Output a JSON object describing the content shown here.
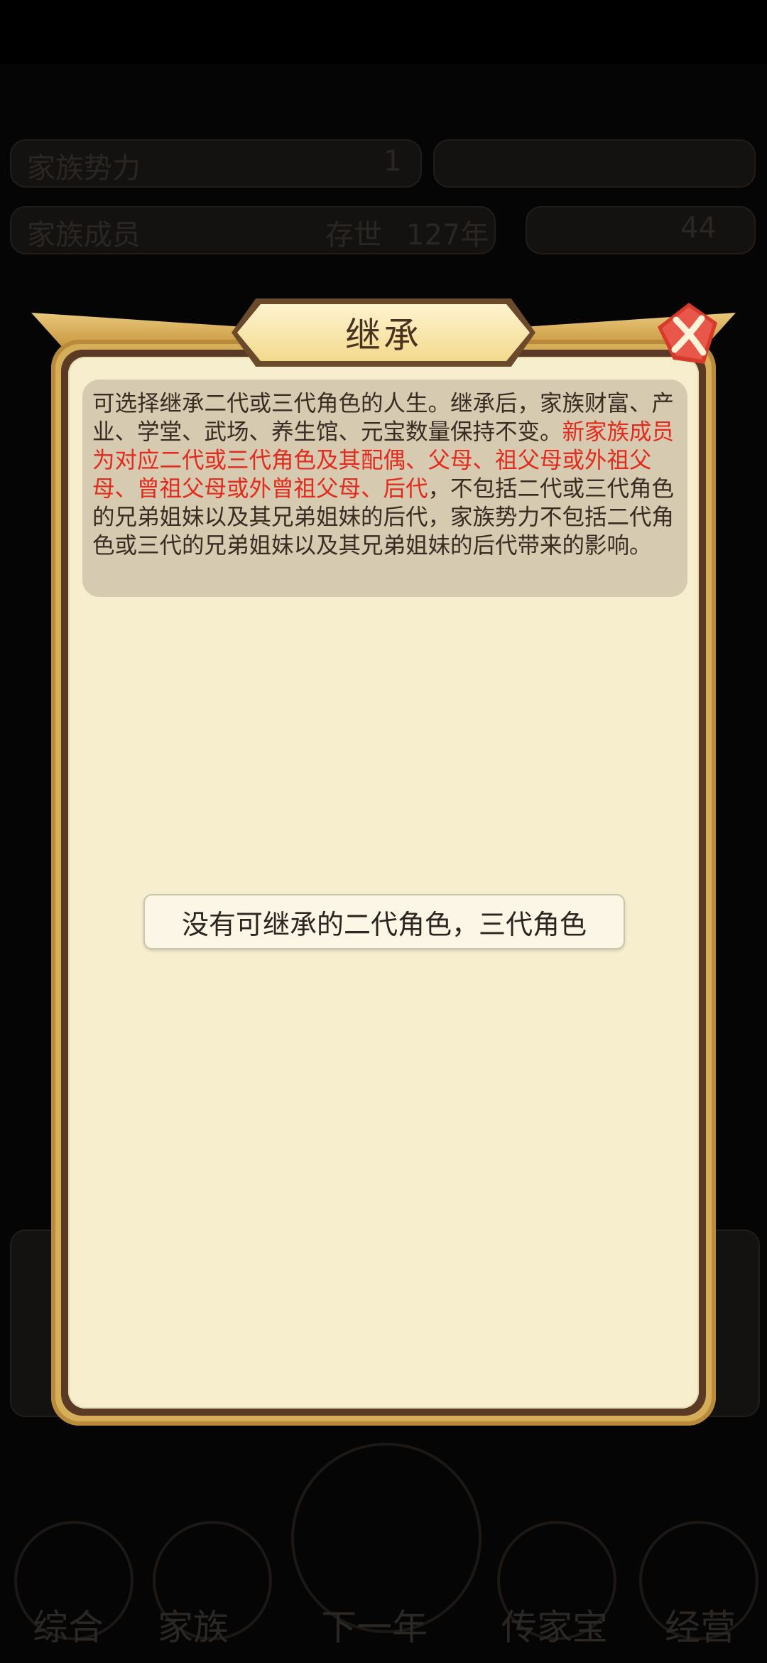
{
  "background": {
    "stat_labels": [
      "家族势力",
      "家族成员",
      "存世"
    ],
    "stat_values": [
      "1",
      "127年",
      "44"
    ],
    "bottom_nav": [
      "综合",
      "家族",
      "下一年",
      "传家宝",
      "经营"
    ]
  },
  "dialog": {
    "title": "继承",
    "description_part1": "可选择继承二代或三代角色的人生。继承后，家族财富、产业、学堂、武场、养生馆、元宝数量保持不变。",
    "description_highlight": "新家族成员为对应二代或三代角色及其配偶、父母、祖父母或外祖父母、曾祖父母或外曾祖父母、后代",
    "description_part2": "，不包括二代或三代角色的兄弟姐妹以及其兄弟姐妹的后代，家族势力不包括二代角色或三代的兄弟姐妹以及其兄弟姐妹的后代带来的影响。",
    "empty_message": "没有可继承的二代角色，三代角色",
    "highlight_color": "#e42a1c",
    "close_icon": "close-x-icon"
  }
}
